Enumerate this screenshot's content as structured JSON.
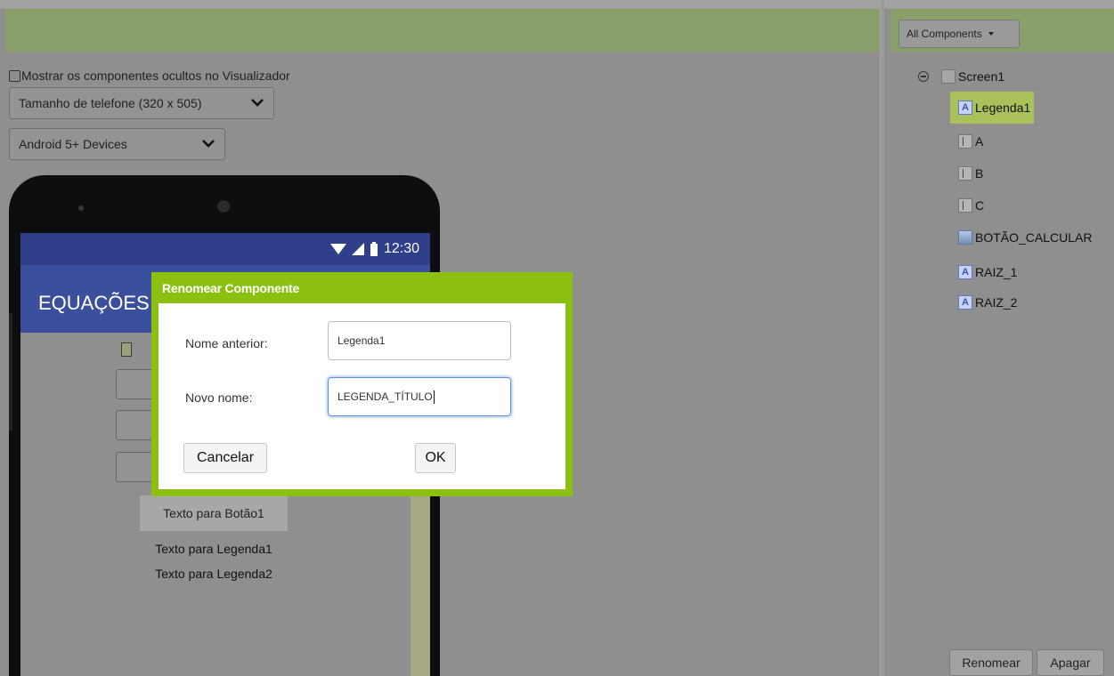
{
  "viewer": {
    "hidden_checkbox_label": "Mostrar os componentes ocultos no Visualizador",
    "phone_size_select": "Tamanho de telefone (320 x 505)",
    "device_select": "Android 5+ Devices"
  },
  "phone": {
    "status_time": "12:30",
    "app_title": "EQUAÇÕES",
    "button_text": "Texto para Botão1",
    "label1_text": "Texto para Legenda1",
    "label2_text": "Texto para Legenda2"
  },
  "dialog": {
    "title": "Renomear Componente",
    "old_name_label": "Nome anterior:",
    "old_name_value": "Legenda1",
    "new_name_label": "Novo nome:",
    "new_name_value": "LEGENDA_TÍTULO",
    "cancel_label": "Cancelar",
    "ok_label": "OK"
  },
  "components": {
    "filter_label": "All Components",
    "tree": [
      {
        "name": "Screen1",
        "icon": "screen-icon"
      },
      {
        "name": "Legenda1",
        "icon": "label-icon",
        "selected": true
      },
      {
        "name": "A",
        "icon": "textbox-icon"
      },
      {
        "name": "B",
        "icon": "textbox-icon"
      },
      {
        "name": "C",
        "icon": "textbox-icon"
      },
      {
        "name": "BOTÃO_CALCULAR",
        "icon": "button-icon"
      },
      {
        "name": "RAIZ_1",
        "icon": "label-icon"
      },
      {
        "name": "RAIZ_2",
        "icon": "label-icon"
      }
    ],
    "rename_label": "Renomear",
    "delete_label": "Apagar"
  },
  "colors": {
    "dialog_accent": "#8bc010",
    "selected_row": "#a9c05b",
    "app_bar": "#3b4f9c"
  }
}
